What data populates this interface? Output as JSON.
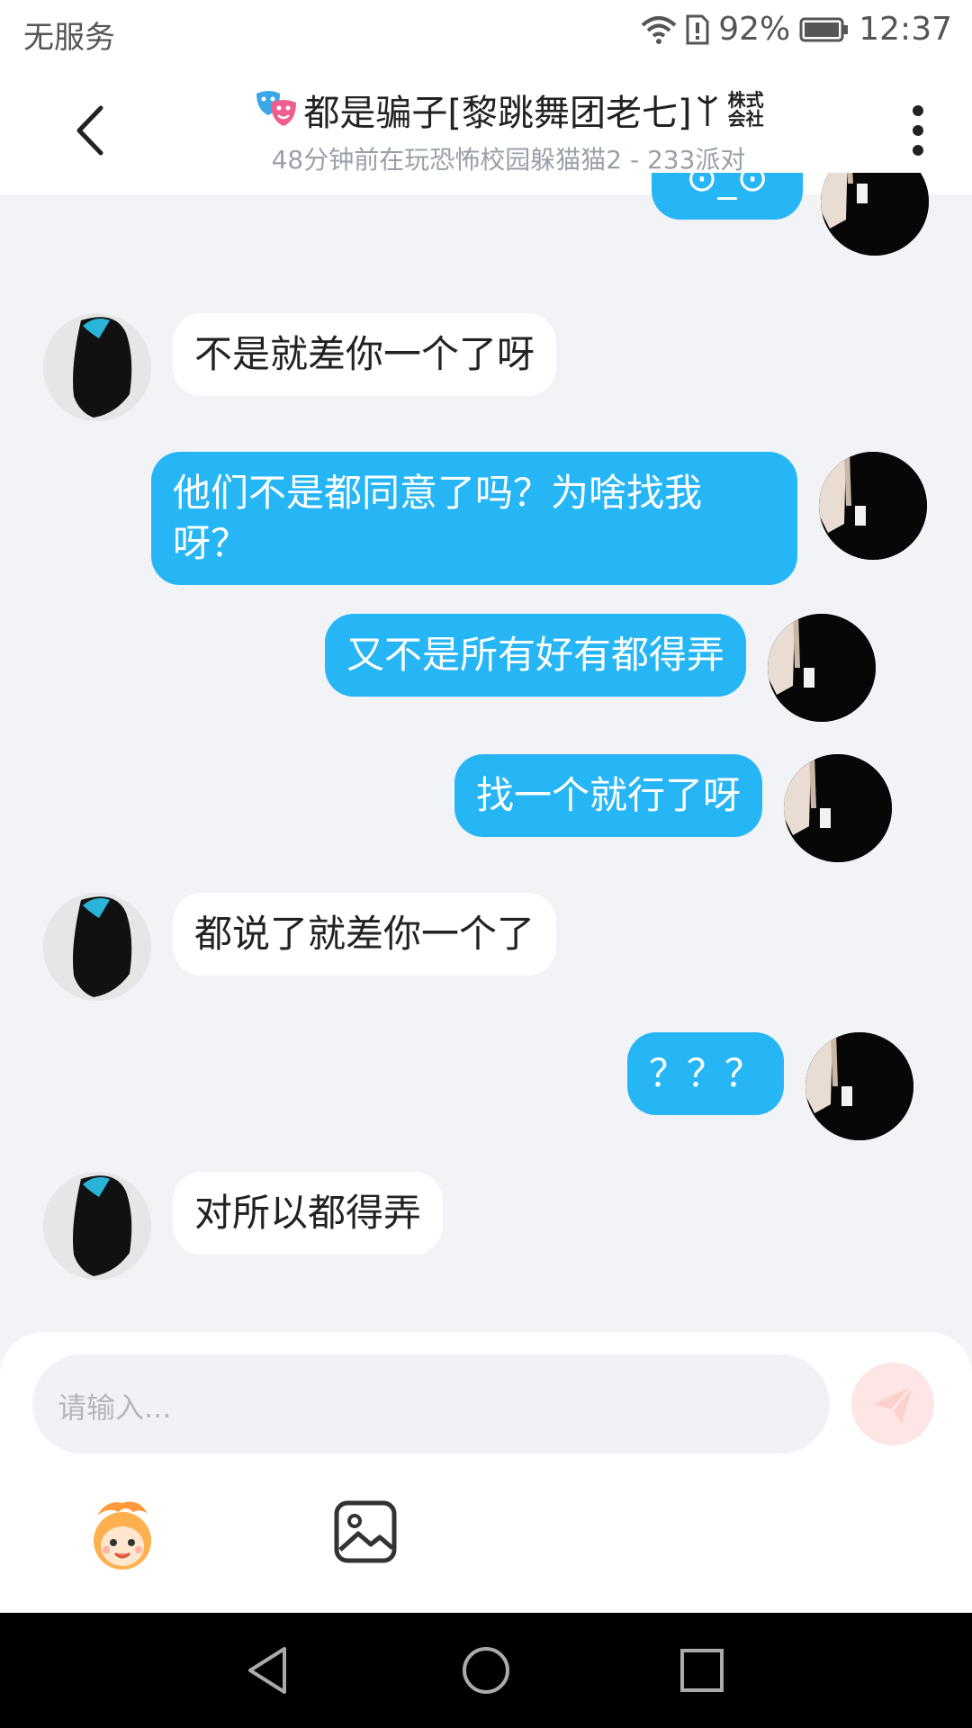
{
  "status_bar": {
    "carrier": "无服务",
    "battery": "92%",
    "time": "12:37"
  },
  "header": {
    "title": "都是骗子[黎跳舞团老七]",
    "title_suffix_1": "株式",
    "title_suffix_2": "会社",
    "subtitle": "48分钟前在玩恐怖校园躲猫猫2 - 233派对"
  },
  "messages": [
    {
      "side": "out",
      "text": "⊙_⊙"
    },
    {
      "side": "in",
      "text": "不是就差你一个了呀"
    },
    {
      "side": "out",
      "text": "他们不是都同意了吗？为啥找我呀？"
    },
    {
      "side": "out",
      "text": "又不是所有好有都得弄"
    },
    {
      "side": "out",
      "text": "找一个就行了呀"
    },
    {
      "side": "in",
      "text": "都说了就差你一个了"
    },
    {
      "side": "out",
      "text": "？？？"
    },
    {
      "side": "in",
      "text": "对所以都得弄"
    }
  ],
  "input": {
    "placeholder": "请输入..."
  },
  "colors": {
    "accent": "#26b6f5",
    "background": "#f1f3f7",
    "send_disabled": "#fde6e5"
  },
  "icons": [
    "back-arrow-icon",
    "more-icon",
    "send-icon",
    "emoji-icon",
    "image-icon",
    "nav-back-icon",
    "nav-home-icon",
    "nav-recents-icon"
  ]
}
